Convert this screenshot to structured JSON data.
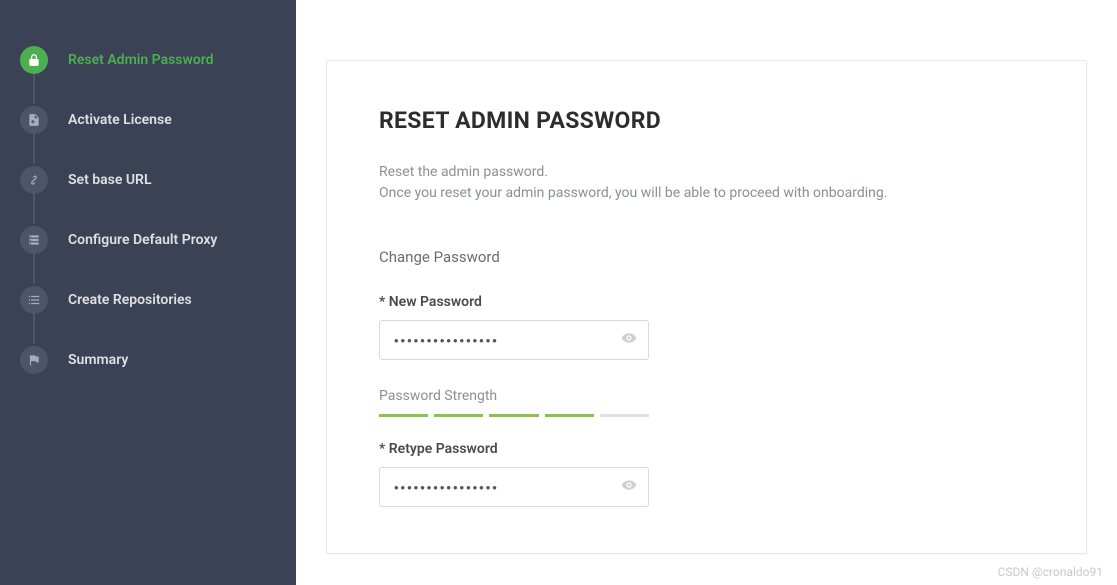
{
  "sidebar": {
    "items": [
      {
        "label": "Reset Admin Password",
        "icon": "lock",
        "active": true
      },
      {
        "label": "Activate License",
        "icon": "doc-plus",
        "active": false
      },
      {
        "label": "Set base URL",
        "icon": "link",
        "active": false
      },
      {
        "label": "Configure Default Proxy",
        "icon": "server",
        "active": false
      },
      {
        "label": "Create Repositories",
        "icon": "list",
        "active": false
      },
      {
        "label": "Summary",
        "icon": "flag",
        "active": false
      }
    ]
  },
  "main": {
    "title": "RESET ADMIN PASSWORD",
    "description_line1": "Reset the admin password.",
    "description_line2": "Once you reset your admin password, you will be able to proceed with onboarding.",
    "section_title": "Change Password",
    "new_password": {
      "label": "* New Password",
      "value": "••••••••••••••••"
    },
    "strength": {
      "label": "Password Strength",
      "filled_bars": 4,
      "total_bars": 5
    },
    "retype_password": {
      "label": "* Retype Password",
      "value": "••••••••••••••••"
    }
  },
  "watermark": "CSDN @cronaldo91"
}
